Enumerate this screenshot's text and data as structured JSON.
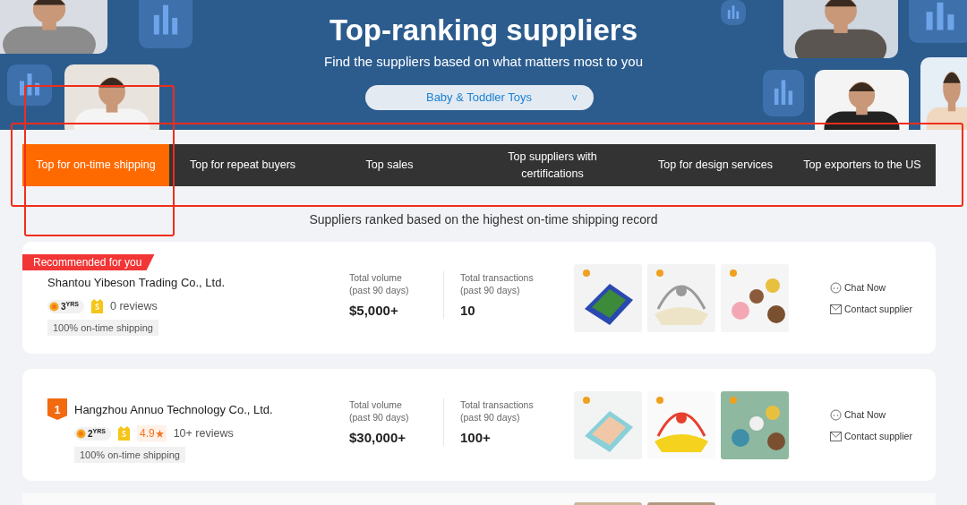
{
  "banner": {
    "title": "Top-ranking suppliers",
    "subtitle": "Find the suppliers based on what matters most to you",
    "category": {
      "value": "Baby & Toddler Toys",
      "caret": "v"
    }
  },
  "tabs": [
    {
      "label": "Top for on-time shipping",
      "selected": true
    },
    {
      "label": "Top for repeat buyers",
      "selected": false
    },
    {
      "label": "Top sales",
      "selected": false
    },
    {
      "label": "Top suppliers with certifications",
      "selected": false
    },
    {
      "label": "Top for design services",
      "selected": false
    },
    {
      "label": "Top exporters to the US",
      "selected": false
    }
  ],
  "ranking_note": "Suppliers ranked based on the highest on-time shipping record",
  "suppliers": [
    {
      "kind": "recommended",
      "badge": "Recommended for you",
      "name": "Shantou Yibeson Trading Co., Ltd.",
      "years": "3$^{YRS}$",
      "verified": true,
      "reviews": "0 reviews",
      "tag": "100% on-time shipping",
      "stats": [
        {
          "label": "Total volume\n(past 90 days)",
          "value": "$5,000+"
        },
        {
          "label": "Total transactions\n(past 90 days)",
          "value": "10"
        }
      ],
      "products": [
        {
          "kind": "picture"
        },
        {
          "kind": "picture"
        },
        {
          "kind": "picture"
        }
      ],
      "actions": [
        "Chat Now",
        "Contact supplier"
      ]
    },
    {
      "kind": "ranked",
      "badge": "1",
      "name": "Hangzhou Annuo Technology Co., Ltd.",
      "years": "2$^{YRS}$",
      "verified": true,
      "rating": "4.9",
      "reviews": "10+ reviews",
      "tag": "100% on-time shipping",
      "stats": [
        {
          "label": "Total volume\n(past 90 days)",
          "value": "$30,000+"
        },
        {
          "label": "Total transactions\n(past 90 days)",
          "value": "100+"
        }
      ],
      "products": [
        {
          "kind": "picture"
        },
        {
          "kind": "picture"
        },
        {
          "kind": "picture"
        }
      ],
      "actions": [
        "Chat Now",
        "Contact supplier"
      ]
    }
  ],
  "partial_card": {
    "products": [
      {
        "kind": "picture"
      },
      {
        "kind": "picture"
      }
    ]
  },
  "annotations": [
    {
      "kind": "frame"
    },
    {
      "kind": "frame"
    }
  ]
}
